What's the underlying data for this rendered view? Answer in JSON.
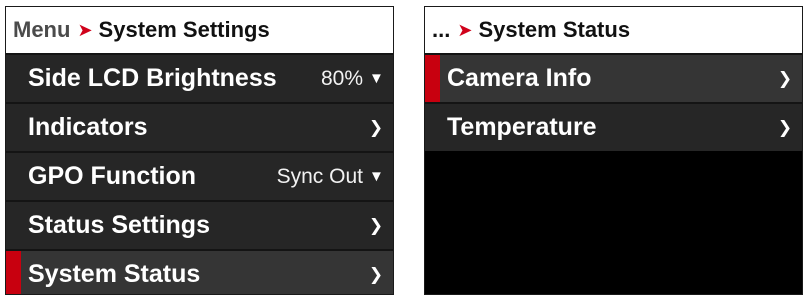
{
  "left_panel": {
    "breadcrumb_parent": "Menu",
    "breadcrumb_current": "System Settings",
    "items": [
      {
        "label": "Side LCD Brightness",
        "value": "80%",
        "indicator": "dropdown"
      },
      {
        "label": "Indicators",
        "indicator": "arrow"
      },
      {
        "label": "GPO Function",
        "value": "Sync Out",
        "indicator": "dropdown"
      },
      {
        "label": "Status Settings",
        "indicator": "arrow"
      },
      {
        "label": "System Status",
        "indicator": "arrow",
        "selected": true
      }
    ]
  },
  "right_panel": {
    "breadcrumb_parent": "...",
    "breadcrumb_current": "System Status",
    "items": [
      {
        "label": "Camera Info",
        "indicator": "arrow",
        "selected": true
      },
      {
        "label": "Temperature",
        "indicator": "arrow"
      }
    ]
  },
  "icons": {
    "breadcrumb_separator": "chevron-right-icon",
    "submenu_arrow": "chevron-right-icon",
    "dropdown": "chevron-down-icon"
  },
  "colors": {
    "accent": "#c8000f",
    "breadcrumb_chevron": "#d0021b",
    "row_background": "#262626",
    "selected_row_background": "#353535",
    "panel_background": "#000000",
    "header_background": "#ffffff"
  }
}
